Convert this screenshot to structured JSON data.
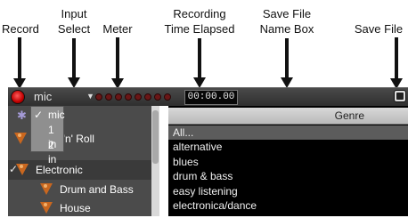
{
  "callouts": {
    "record": "Record",
    "input_select_1": "Input",
    "input_select_2": "Select",
    "meter": "Meter",
    "elapsed_1": "Recording",
    "elapsed_2": "Time Elapsed",
    "save_name_1": "Save File",
    "save_name_2": "Name Box",
    "save_file": "Save File"
  },
  "toolbar": {
    "input_name": "mic",
    "select_arrow": "▼",
    "meter_leds": 8,
    "elapsed_time": "00:00.00",
    "save_icon": "floppy-disk-icon",
    "record_color": "#d11a1a"
  },
  "input_dropdown": {
    "options": [
      {
        "label": "mic",
        "checked": true,
        "check": "✓"
      },
      {
        "label": "1 in",
        "checked": false,
        "check": ""
      },
      {
        "label": "2 in",
        "checked": false,
        "check": ""
      }
    ]
  },
  "tree": {
    "items": [
      {
        "label": "Rock 'n' Roll",
        "icon": "crate-cone-icon"
      },
      {
        "label": "Electronic",
        "icon": "crate-cone-icon",
        "selected": true
      },
      {
        "label": "Drum and Bass",
        "icon": "crate-cone-icon"
      },
      {
        "label": "House",
        "icon": "crate-cone-icon"
      }
    ]
  },
  "genre_panel": {
    "header": "Genre",
    "rows": [
      "All...",
      "alternative",
      "blues",
      "drum & bass",
      "easy listening",
      "electronica/dance"
    ]
  }
}
